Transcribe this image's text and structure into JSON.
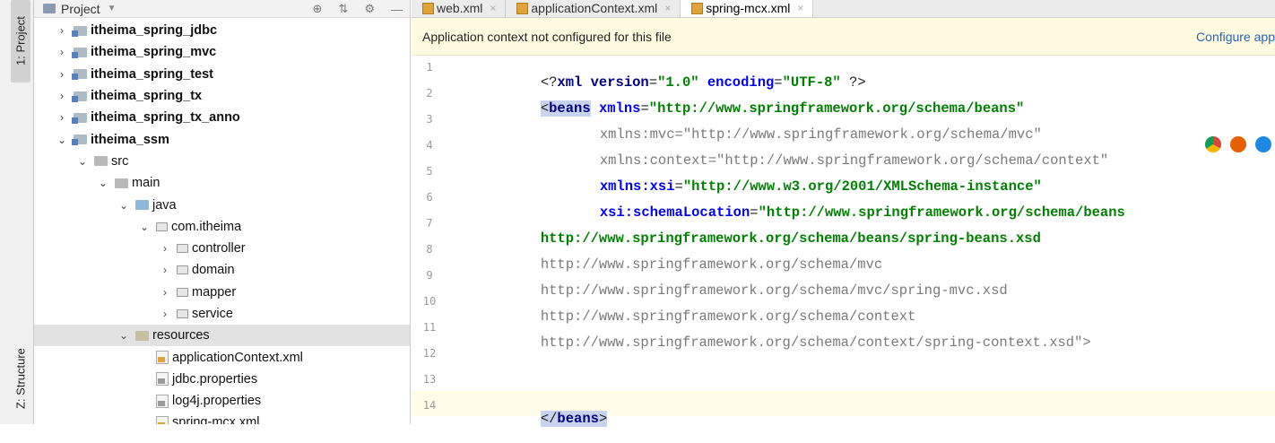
{
  "tool_strip": {
    "project_tab": "1: Project",
    "structure_tab": "Z: Structure"
  },
  "project_panel": {
    "title": "Project",
    "tree": [
      {
        "label": "itheima_spring_jdbc",
        "type": "module",
        "depth": 0,
        "arrow": "›",
        "bold": true
      },
      {
        "label": "itheima_spring_mvc",
        "type": "module",
        "depth": 0,
        "arrow": "›",
        "bold": true
      },
      {
        "label": "itheima_spring_test",
        "type": "module",
        "depth": 0,
        "arrow": "›",
        "bold": true
      },
      {
        "label": "itheima_spring_tx",
        "type": "module",
        "depth": 0,
        "arrow": "›",
        "bold": true
      },
      {
        "label": "itheima_spring_tx_anno",
        "type": "module",
        "depth": 0,
        "arrow": "›",
        "bold": true
      },
      {
        "label": "itheima_ssm",
        "type": "module",
        "depth": 0,
        "arrow": "⌄",
        "bold": true
      },
      {
        "label": "src",
        "type": "src",
        "depth": 1,
        "arrow": "⌄"
      },
      {
        "label": "main",
        "type": "src",
        "depth": 2,
        "arrow": "⌄"
      },
      {
        "label": "java",
        "type": "java",
        "depth": 3,
        "arrow": "⌄"
      },
      {
        "label": "com.itheima",
        "type": "pkg",
        "depth": 4,
        "arrow": "⌄"
      },
      {
        "label": "controller",
        "type": "pkg",
        "depth": 5,
        "arrow": "›"
      },
      {
        "label": "domain",
        "type": "pkg",
        "depth": 5,
        "arrow": "›"
      },
      {
        "label": "mapper",
        "type": "pkg",
        "depth": 5,
        "arrow": "›"
      },
      {
        "label": "service",
        "type": "pkg",
        "depth": 5,
        "arrow": "›"
      },
      {
        "label": "resources",
        "type": "res",
        "depth": 3,
        "arrow": "⌄",
        "selected": true
      },
      {
        "label": "applicationContext.xml",
        "type": "xml",
        "depth": 4,
        "arrow": ""
      },
      {
        "label": "jdbc.properties",
        "type": "props",
        "depth": 4,
        "arrow": ""
      },
      {
        "label": "log4j.properties",
        "type": "props",
        "depth": 4,
        "arrow": ""
      },
      {
        "label": "spring-mcx.xml",
        "type": "xml",
        "depth": 4,
        "arrow": ""
      }
    ]
  },
  "editor": {
    "tabs": [
      {
        "label": "web.xml",
        "active": false
      },
      {
        "label": "applicationContext.xml",
        "active": false
      },
      {
        "label": "spring-mcx.xml",
        "active": true
      }
    ],
    "banner_text": "Application context not configured for this file",
    "banner_action": "Configure app",
    "gutter": [
      "1",
      "2",
      "3",
      "4",
      "5",
      "6",
      "7",
      "8",
      "9",
      "10",
      "11",
      "12",
      "13",
      "14"
    ],
    "code": {
      "l1_a": "<?",
      "l1_b": "xml version",
      "l1_c": "=",
      "l1_d": "\"1.0\"",
      "l1_e": " encoding",
      "l1_f": "=",
      "l1_g": "\"UTF-8\"",
      "l1_h": " ?>",
      "l2_open": "<",
      "l2_tag": "beans",
      "l2_attr": " xmlns",
      "l2_eq": "=",
      "l2_val": "\"http://www.springframework.org/schema/beans\"",
      "l3_attr": "xmlns:mvc",
      "l3_eq": "=",
      "l3_val": "\"http://www.springframework.org/schema/mvc\"",
      "l4_attr": "xmlns:context",
      "l4_eq": "=",
      "l4_val": "\"http://www.springframework.org/schema/context\"",
      "l5_attr": "xmlns:xsi",
      "l5_eq": "=",
      "l5_val": "\"http://www.w3.org/2001/XMLSchema-instance\"",
      "l6_attr": "xsi:schemaLocation",
      "l6_eq": "=",
      "l6_val": "\"http://www.springframework.org/schema/beans",
      "l7": "http://www.springframework.org/schema/beans/spring-beans.xsd",
      "l8": "http://www.springframework.org/schema/mvc",
      "l9": "http://www.springframework.org/schema/mvc/spring-mvc.xsd",
      "l10": "http://www.springframework.org/schema/context",
      "l11": "http://www.springframework.org/schema/context/spring-context.xsd\">",
      "l14_open": "</",
      "l14_tag": "beans",
      "l14_close": ">"
    }
  },
  "colors": {
    "tag": "#000080",
    "attr": "#0000ff",
    "value": "#008000",
    "banner_bg": "#fffbe0",
    "link": "#2a62b8"
  }
}
